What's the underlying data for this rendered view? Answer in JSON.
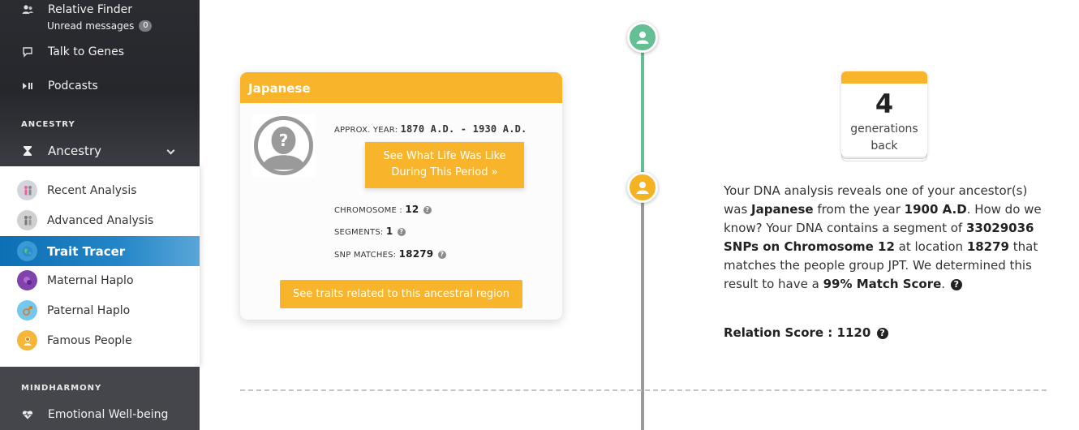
{
  "sidebar": {
    "top_items": [
      {
        "label": "Relative Finder",
        "icon": "relatives-icon"
      },
      {
        "label": "Talk to Genes",
        "icon": "chat-icon"
      },
      {
        "label": "Podcasts",
        "icon": "play-pause-icon"
      }
    ],
    "unread_label": "Unread messages",
    "unread_count": "0",
    "section_ancestry": "ANCESTRY",
    "ancestry_toggle": "Ancestry",
    "ancestry_items": [
      {
        "label": "Recent Analysis",
        "color": "#c9c9d4"
      },
      {
        "label": "Advanced Analysis",
        "color": "#c9c9c9"
      },
      {
        "label": "Trait Tracer",
        "color": "#3aa0d8",
        "active": true
      },
      {
        "label": "Maternal Haplo",
        "color": "#7b3fa8"
      },
      {
        "label": "Paternal Haplo",
        "color": "#6cc3e8"
      },
      {
        "label": "Famous People",
        "color": "#f4b63a"
      }
    ],
    "section_mind": "MINDHARMONY",
    "mind_item": "Emotional Well-being"
  },
  "card": {
    "title": "Japanese",
    "approx_label": "APPROX. YEAR:",
    "approx_value": "1870 A.D. - 1930 A.D.",
    "life_button": "See What Life Was Like During This Period »",
    "chromosome_label": "CHROMOSOME :",
    "chromosome_value": "12",
    "segments_label": "SEGMENTS:",
    "segments_value": "1",
    "snp_label": "SNP MATCHES:",
    "snp_value": "18279",
    "traits_button": "See traits related to this ancestral region"
  },
  "generations": {
    "number": "4",
    "line1": "generations",
    "line2": "back"
  },
  "description": {
    "t1": "Your DNA analysis reveals one of your ancestor(s) was ",
    "group": "Japanese",
    "t2": " from the year ",
    "year": "1900 A.D",
    "t3": ". How do we know? Your DNA contains a segment of ",
    "snps": "33029036 SNPs on Chromosome 12",
    "t4": " at location ",
    "location": "18279",
    "t5": " that matches the people group JPT. We determined this result to have a ",
    "match": "99% Match Score",
    "t6": "."
  },
  "relation_score": "Relation Score : 1120",
  "colors": {
    "accent_orange": "#f8b52c",
    "timeline_green": "#64bf94",
    "active_blue": "#1b7fc2"
  }
}
